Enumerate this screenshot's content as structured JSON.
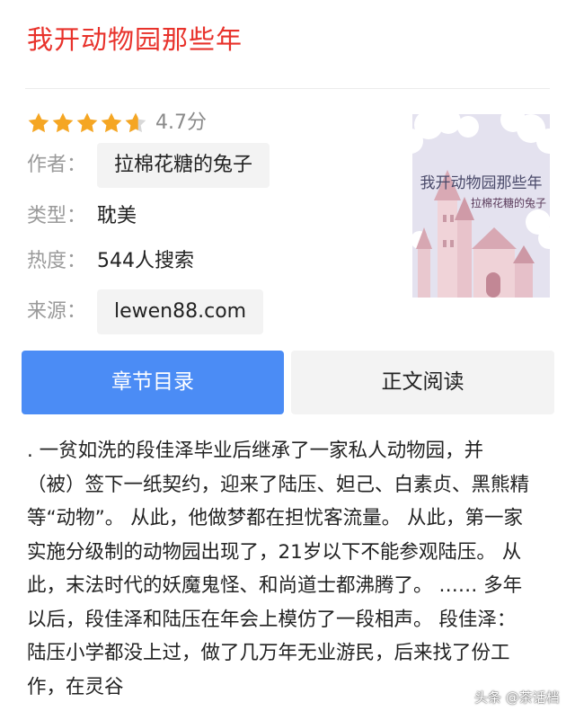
{
  "book": {
    "title": "我开动物园那些年",
    "rating": {
      "stars": 4.7,
      "max_stars": 5,
      "score_text": "4.7分"
    },
    "author_label": "作者：",
    "author": "拉棉花糖的兔子",
    "genre_label": "类型：",
    "genre": "耽美",
    "popularity_label": "热度：",
    "popularity": "544人搜索",
    "source_label": "来源：",
    "source": "lewen88.com",
    "cover": {
      "title": "我开动物园那些年",
      "author": "拉棉花糖的兔子"
    }
  },
  "actions": {
    "toc_label": "章节目录",
    "read_label": "正文阅读"
  },
  "description": ". 一贫如洗的段佳泽毕业后继承了一家私人动物园，并（被）签下一纸契约，迎来了陆压、妲己、白素贞、黑熊精等“动物”。 从此，他做梦都在担忧客流量。 从此，第一家实施分级制的动物园出现了，21岁以下不能参观陆压。 从此，末法时代的妖魔鬼怪、和尚道士都沸腾了。 …… 多年以后，段佳泽和陆压在年会上模仿了一段相声。 段佳泽：陆压小学都没上过，做了几万年无业游民，后来找了份工作，在灵谷",
  "watermark": {
    "text": "头条 @茶话档"
  },
  "colors": {
    "title": "#e8322b",
    "star": "#f5a623",
    "primary_button": "#4b8cf5",
    "secondary_button": "#f3f3f3"
  }
}
